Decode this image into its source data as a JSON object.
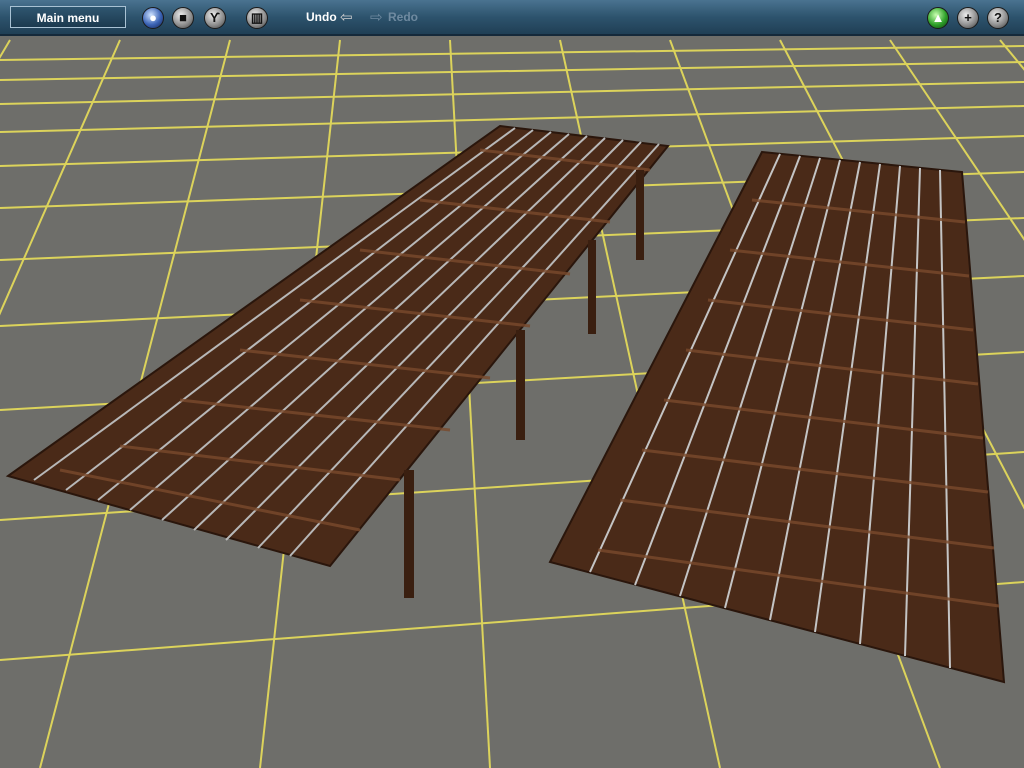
{
  "toolbar": {
    "main_menu_label": "Main menu",
    "undo_label": "Undo",
    "redo_label": "Redo",
    "icons": {
      "left": [
        "globe-icon",
        "stop-icon",
        "tools-icon",
        "bin-icon"
      ],
      "right": [
        "status-light-icon",
        "add-icon",
        "help-icon"
      ]
    },
    "help_glyph": "?",
    "add_glyph": "+"
  },
  "scene": {
    "ground_color": "#6e6e6a",
    "grid_color": "#e8de5a",
    "deck_color": "#4a2a18",
    "rail_color": "#b8b8b8"
  }
}
